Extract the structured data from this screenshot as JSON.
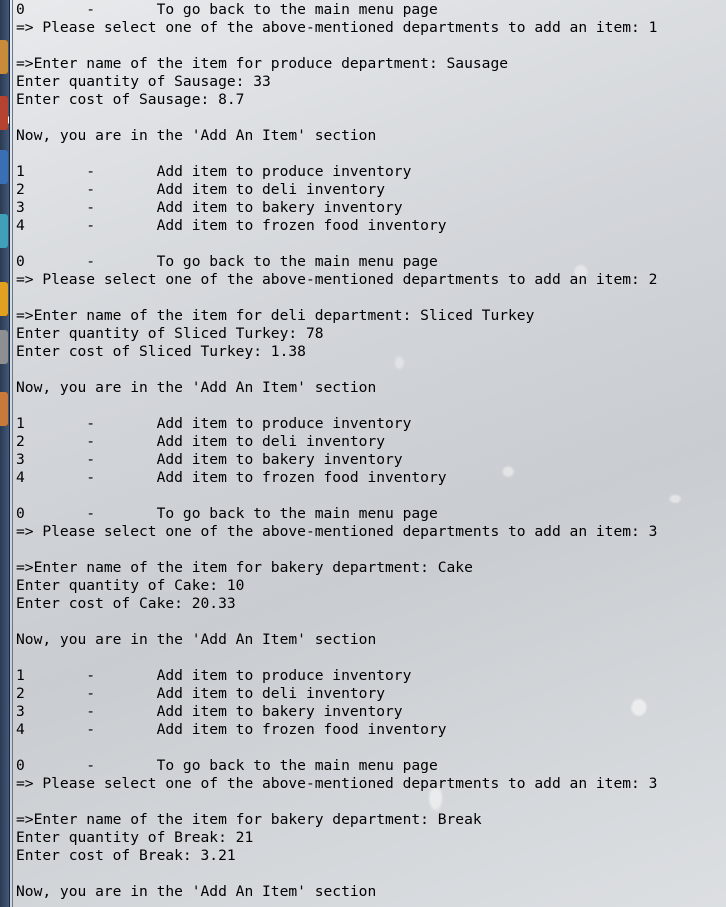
{
  "launcher": {
    "icons": [
      {
        "name": "files-icon",
        "color": "#c98a3a"
      },
      {
        "name": "browser-icon",
        "color": "#b5432f"
      },
      {
        "name": "office-icon",
        "color": "#3a6fb5"
      },
      {
        "name": "terminal-icon",
        "color": "#3fa0b8"
      },
      {
        "name": "software-center-icon",
        "color": "#e0a020"
      },
      {
        "name": "settings-icon",
        "color": "#8e8f91"
      },
      {
        "name": "apps-icon",
        "color": "#c97a3a"
      }
    ]
  },
  "terminal": {
    "lines": [
      "0       -       To go back to the main menu page",
      "=> Please select one of the above-mentioned departments to add an item: 1",
      "",
      "=>Enter name of the item for produce department: Sausage",
      "Enter quantity of Sausage: 33",
      "Enter cost of Sausage: 8.7",
      "",
      "Now, you are in the 'Add An Item' section",
      "",
      "1       -       Add item to produce inventory",
      "2       -       Add item to deli inventory",
      "3       -       Add item to bakery inventory",
      "4       -       Add item to frozen food inventory",
      "",
      "0       -       To go back to the main menu page",
      "=> Please select one of the above-mentioned departments to add an item: 2",
      "",
      "=>Enter name of the item for deli department: Sliced Turkey",
      "Enter quantity of Sliced Turkey: 78",
      "Enter cost of Sliced Turkey: 1.38",
      "",
      "Now, you are in the 'Add An Item' section",
      "",
      "1       -       Add item to produce inventory",
      "2       -       Add item to deli inventory",
      "3       -       Add item to bakery inventory",
      "4       -       Add item to frozen food inventory",
      "",
      "0       -       To go back to the main menu page",
      "=> Please select one of the above-mentioned departments to add an item: 3",
      "",
      "=>Enter name of the item for bakery department: Cake",
      "Enter quantity of Cake: 10",
      "Enter cost of Cake: 20.33",
      "",
      "Now, you are in the 'Add An Item' section",
      "",
      "1       -       Add item to produce inventory",
      "2       -       Add item to deli inventory",
      "3       -       Add item to bakery inventory",
      "4       -       Add item to frozen food inventory",
      "",
      "0       -       To go back to the main menu page",
      "=> Please select one of the above-mentioned departments to add an item: 3",
      "",
      "=>Enter name of the item for bakery department: Break",
      "Enter quantity of Break: 21",
      "Enter cost of Break: 3.21",
      "",
      "Now, you are in the 'Add An Item' section"
    ]
  }
}
